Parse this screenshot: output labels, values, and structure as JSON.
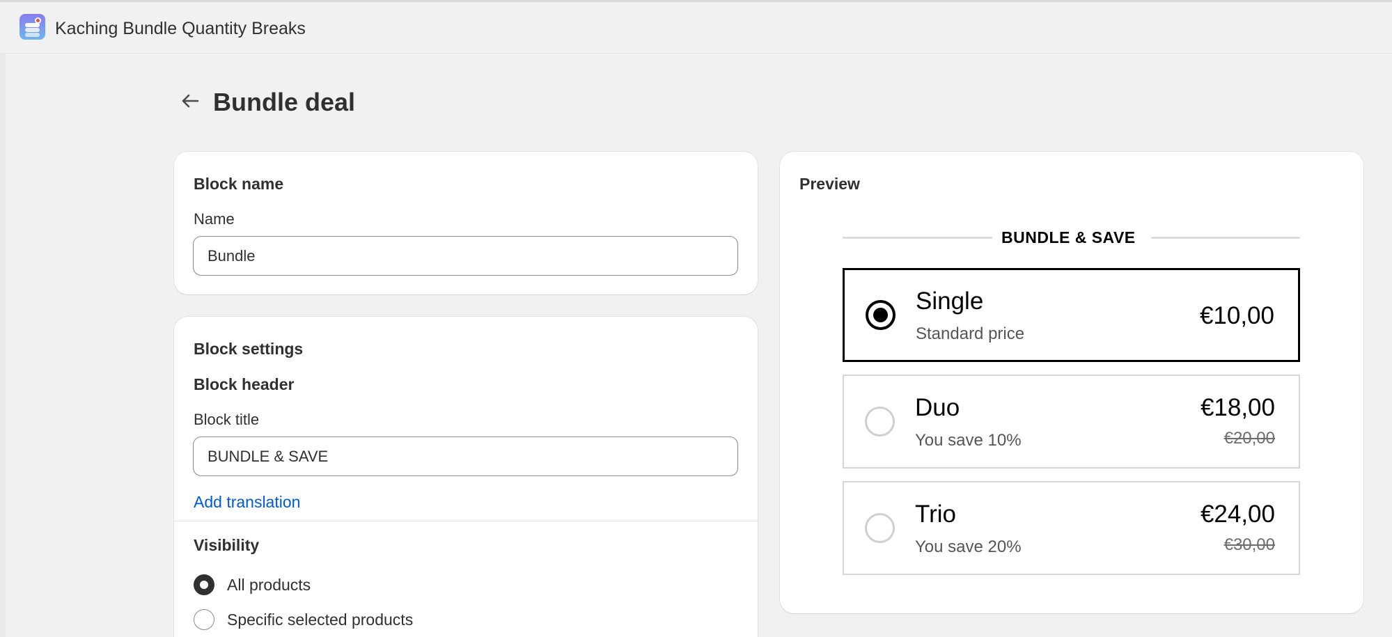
{
  "app": {
    "name": "Kaching Bundle Quantity Breaks",
    "icon": "app-logo-icon"
  },
  "header": {
    "title": "Bundle deal",
    "back_icon": "arrow-left-icon"
  },
  "block_name_card": {
    "heading": "Block name",
    "name_label": "Name",
    "name_value": "Bundle"
  },
  "block_settings_card": {
    "heading": "Block settings",
    "subheading": "Block header",
    "title_label": "Block title",
    "title_value": "BUNDLE & SAVE",
    "add_translation": "Add translation",
    "visibility_heading": "Visibility",
    "visibility_options": [
      {
        "label": "All products",
        "selected": true
      },
      {
        "label": "Specific selected products",
        "selected": false
      }
    ]
  },
  "preview": {
    "heading": "Preview",
    "block_title": "BUNDLE & SAVE",
    "offers": [
      {
        "title": "Single",
        "subtitle": "Standard price",
        "price": "€10,00",
        "compare_price": "",
        "selected": true
      },
      {
        "title": "Duo",
        "subtitle": "You save 10%",
        "price": "€18,00",
        "compare_price": "€20,00",
        "selected": false
      },
      {
        "title": "Trio",
        "subtitle": "You save 20%",
        "price": "€24,00",
        "compare_price": "€30,00",
        "selected": false
      }
    ]
  },
  "colors": {
    "background": "#f1f1f1",
    "card": "#ffffff",
    "link": "#005bd3",
    "text": "#303030",
    "selected_border": "#000000"
  }
}
